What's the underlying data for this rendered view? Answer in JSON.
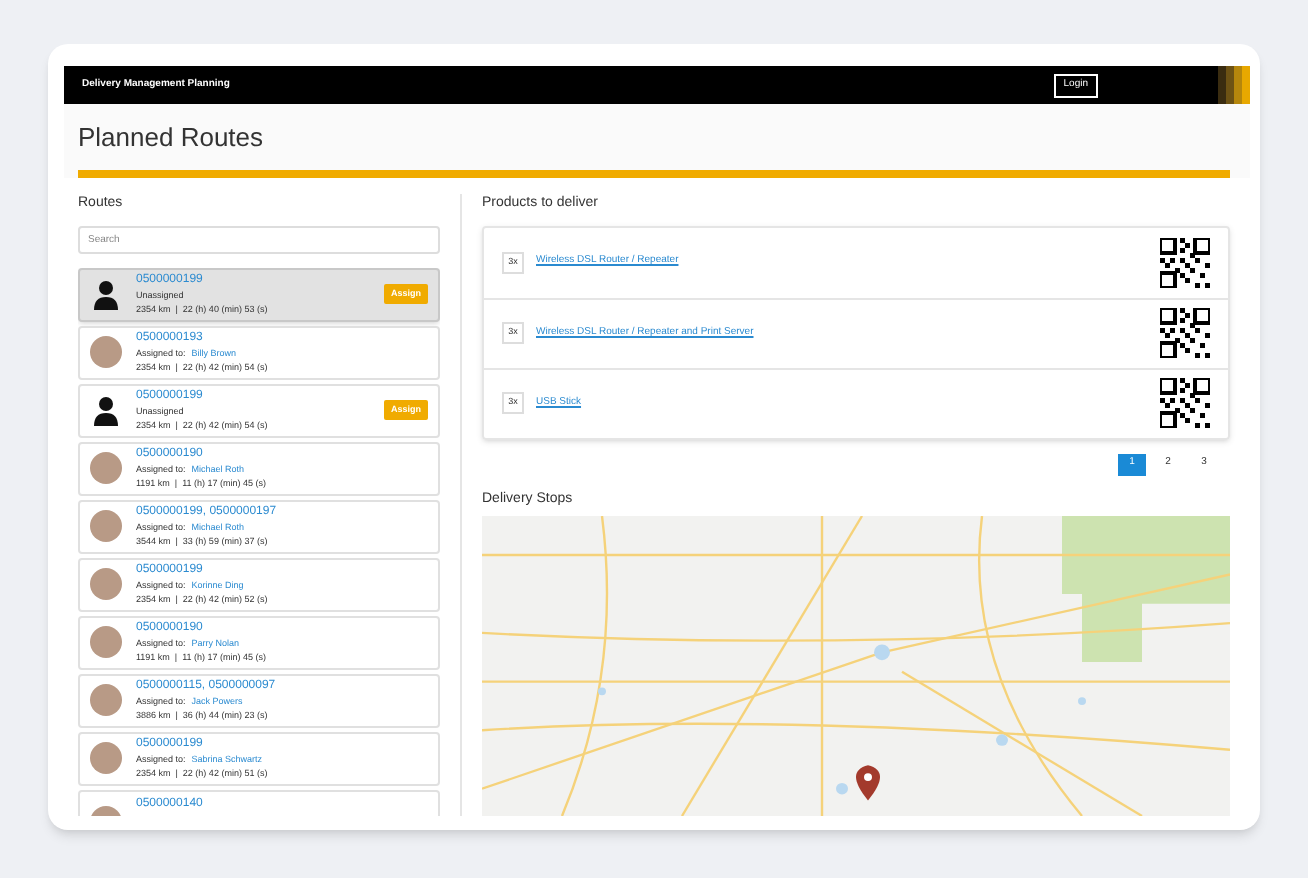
{
  "header": {
    "title": "Delivery Management Planning",
    "login": "Login"
  },
  "page_title": "Planned Routes",
  "routes": {
    "title": "Routes",
    "search": {
      "placeholder": "Search"
    },
    "items": [
      {
        "ids": "0500000199",
        "kind": "unassigned",
        "status": "Unassigned",
        "stats": "2354 km  |  22 (h) 40 (min) 53 (s)",
        "action": "Assign",
        "selected": true
      },
      {
        "ids": "0500000193",
        "kind": "assigned",
        "assignee_label": "Assigned to:",
        "assignee": "Billy Brown",
        "stats": "2354 km  |  22 (h) 42 (min) 54 (s)",
        "selected": false
      },
      {
        "ids": "0500000199",
        "kind": "unassigned",
        "status": "Unassigned",
        "stats": "2354 km  |  22 (h) 42 (min) 54 (s)",
        "action": "Assign",
        "selected": false
      },
      {
        "ids": "0500000190",
        "kind": "assigned",
        "assignee_label": "Assigned to:",
        "assignee": "Michael Roth",
        "stats": "1191 km  |  11 (h) 17 (min) 45 (s)",
        "selected": false
      },
      {
        "ids": "0500000199, 0500000197",
        "kind": "assigned",
        "assignee_label": "Assigned to:",
        "assignee": "Michael Roth",
        "stats": "3544 km  |  33 (h) 59 (min) 37 (s)",
        "selected": false
      },
      {
        "ids": "0500000199",
        "kind": "assigned",
        "assignee_label": "Assigned to:",
        "assignee": "Korinne Ding",
        "stats": "2354 km  |  22 (h) 42 (min) 52 (s)",
        "selected": false
      },
      {
        "ids": "0500000190",
        "kind": "assigned",
        "assignee_label": "Assigned to:",
        "assignee": "Parry Nolan",
        "stats": "1191 km  |  11 (h) 17 (min) 45 (s)",
        "selected": false
      },
      {
        "ids": "0500000115, 0500000097",
        "kind": "assigned",
        "assignee_label": "Assigned to:",
        "assignee": "Jack Powers",
        "stats": "3886 km  |  36 (h) 44 (min) 23 (s)",
        "selected": false
      },
      {
        "ids": "0500000199",
        "kind": "assigned",
        "assignee_label": "Assigned to:",
        "assignee": "Sabrina Schwartz",
        "stats": "2354 km  |  22 (h) 42 (min) 51 (s)",
        "selected": false
      },
      {
        "ids": "0500000140",
        "kind": "partial",
        "selected": false
      }
    ]
  },
  "products": {
    "title": "Products to deliver",
    "items": [
      {
        "quantity": "3x",
        "name": "Wireless DSL Router / Repeater"
      },
      {
        "quantity": "3x",
        "name": "Wireless DSL Router / Repeater and Print Server"
      },
      {
        "quantity": "3x",
        "name": "USB Stick"
      }
    ],
    "pages": [
      {
        "label": "1",
        "selected": true
      },
      {
        "label": "2",
        "selected": false
      },
      {
        "label": "3",
        "selected": false
      }
    ]
  },
  "delivery_stops": {
    "title": "Delivery Stops"
  }
}
